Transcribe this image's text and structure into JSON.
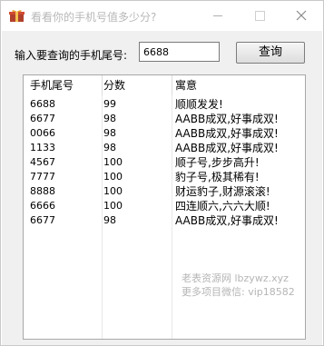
{
  "window": {
    "title": "看看你的手机号值多少分?"
  },
  "form": {
    "prompt_label": "输入要查询的手机尾号:",
    "input_value": "6688",
    "query_button": "查询"
  },
  "table": {
    "columns": [
      "手机尾号",
      "分数",
      "寓意"
    ],
    "rows": [
      [
        "6688",
        "99",
        "顺顺发发!"
      ],
      [
        "6677",
        "98",
        "AABB成双,好事成双!"
      ],
      [
        "0066",
        "98",
        "AABB成双,好事成双!"
      ],
      [
        "1133",
        "98",
        "AABB成双,好事成双!"
      ],
      [
        "4567",
        "100",
        "顺子号,步步高升!"
      ],
      [
        "7777",
        "100",
        "豹子号,极其稀有!"
      ],
      [
        "8888",
        "100",
        "财运豹子,财源滚滚!"
      ],
      [
        "6666",
        "100",
        "四连顺六,六六大顺!"
      ],
      [
        "6677",
        "98",
        "AABB成双,好事成双!"
      ]
    ]
  },
  "watermark": {
    "line1": "老表资源网  lbzywz.xyz",
    "line2": "更多项目微信: vip18582"
  }
}
